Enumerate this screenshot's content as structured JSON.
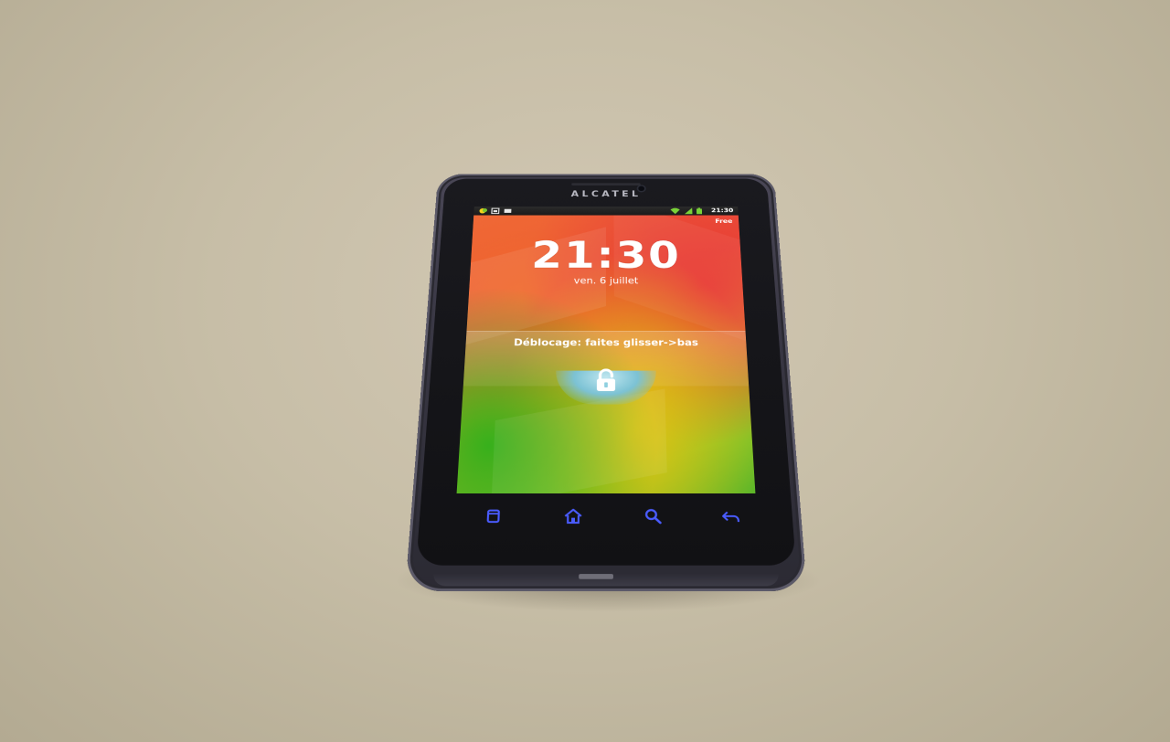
{
  "phone": {
    "brand": "ALCATEL"
  },
  "status_bar": {
    "time": "21:30",
    "icons": [
      "notification-icon",
      "calendar-icon",
      "message-icon",
      "wifi-icon",
      "signal-icon",
      "battery-icon"
    ]
  },
  "lock_screen": {
    "carrier": "Free",
    "clock": "21:30",
    "date": "ven. 6 juillet",
    "unlock_hint": "Déblocage: faites glisser->bas"
  },
  "nav_keys": [
    "menu-key-icon",
    "home-key-icon",
    "search-key-icon",
    "back-key-icon"
  ],
  "colors": {
    "table": "#c7bea7",
    "phone_body": "#3a3845",
    "nav_key_accent": "#4a5cff",
    "wallpaper_red": "#e83a33",
    "wallpaper_yellow": "#e2c312",
    "wallpaper_green": "#37b01c",
    "lock_handle": "#8fd0e0"
  }
}
